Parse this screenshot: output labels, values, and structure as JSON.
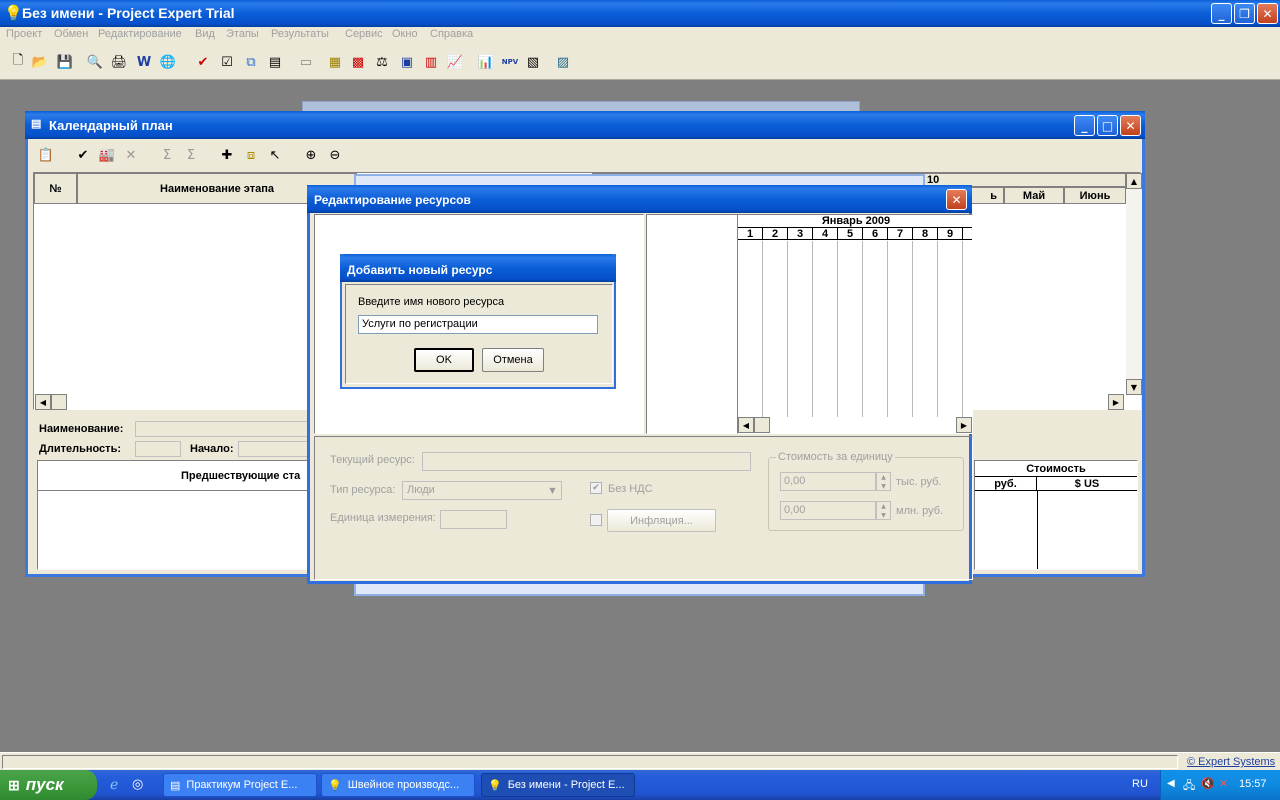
{
  "app": {
    "title": "Без имени - Project Expert Trial",
    "menu": [
      "Проект",
      "Обмен",
      "Редактирование",
      "Вид",
      "Этапы",
      "Результаты",
      "Сервис",
      "Окно",
      "Справка"
    ]
  },
  "calendar": {
    "title": "Календарный план",
    "col_num": "№",
    "col_name": "Наименование этапа",
    "year_fragment": "10",
    "months": [
      "ь",
      "Май",
      "Июнь"
    ],
    "label_name": "Наименование:",
    "label_duration": "Длительность:",
    "label_start": "Начало:",
    "predecessors": "Предшествующие ста",
    "cost_header": "Стоимость",
    "cost_rub": "руб.",
    "cost_usd": "$ US"
  },
  "resources": {
    "title": "Редактирование ресурсов",
    "gantt_month": "Январь 2009",
    "gantt_days": [
      "1",
      "2",
      "3",
      "4",
      "5",
      "6",
      "7",
      "8",
      "9"
    ],
    "label_current": "Текущий ресурс:",
    "label_type": "Тип ресурса:",
    "type_value": "Люди",
    "label_unit": "Единица измерения:",
    "vat_label": "Без НДС",
    "inflation_button": "Инфляция...",
    "unit_cost_group": "Стоимость за единицу",
    "cost_value_1": "0,00",
    "cost_unit_1": "тыс. руб.",
    "cost_value_2": "0,00",
    "cost_unit_2": "млн. руб."
  },
  "dialog": {
    "title": "Добавить новый ресурс",
    "prompt": "Введите имя нового ресурса",
    "input_value": "Услуги по регистрации",
    "ok": "OK",
    "cancel": "Отмена"
  },
  "status": {
    "copyright": "© Expert Systems"
  },
  "taskbar": {
    "start": "пуск",
    "tasks": [
      "Практикум Project E...",
      "Швейное производс...",
      "Без имени - Project E..."
    ],
    "lang": "RU",
    "clock": "15:57"
  },
  "colors": {
    "xp_blue": "#0b5ed7",
    "start_green": "#3c9a3c",
    "desktop_grey": "#7f7f7f"
  }
}
